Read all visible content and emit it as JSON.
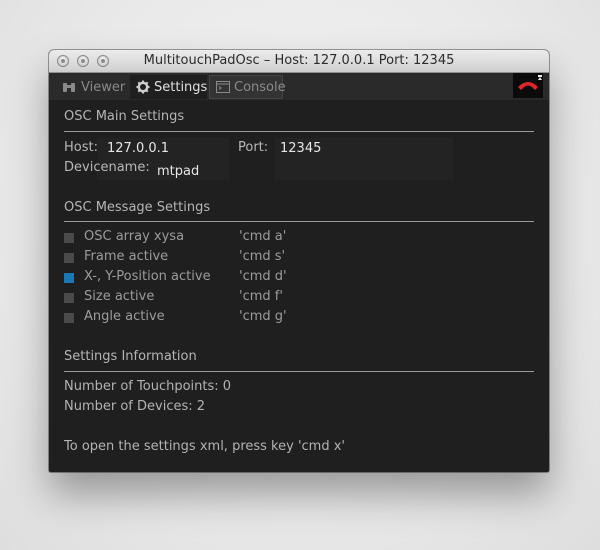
{
  "window": {
    "title": "MultitouchPadOsc – Host: 127.0.0.1 Port: 12345"
  },
  "tabs": [
    {
      "label": "Viewer",
      "icon": "binoculars-icon",
      "active": false
    },
    {
      "label": "Settings",
      "icon": "gear-icon",
      "active": true
    },
    {
      "label": "Console",
      "icon": "console-icon",
      "active": false
    }
  ],
  "toolbar": {
    "connection_icon": "phone-icon",
    "accent": "#e0242a"
  },
  "main_settings": {
    "title": "OSC Main Settings",
    "host_label": "Host:",
    "host_value": "127.0.0.1",
    "port_label": "Port:",
    "port_value": "12345",
    "device_label": "Devicename:",
    "device_value": "mtpad"
  },
  "message_settings": {
    "title": "OSC Message Settings",
    "items": [
      {
        "label": "OSC array xysa",
        "command": "'cmd a'",
        "checked": false
      },
      {
        "label": "Frame active",
        "command": "'cmd s'",
        "checked": false
      },
      {
        "label": "X-, Y-Position active",
        "command": "'cmd d'",
        "checked": true
      },
      {
        "label": "Size active",
        "command": "'cmd f'",
        "checked": false
      },
      {
        "label": "Angle active",
        "command": "'cmd g'",
        "checked": false
      }
    ],
    "checked_color": "#1a79b3"
  },
  "info": {
    "title": "Settings Information",
    "touchpoints": "Number of Touchpoints: 0",
    "devices": "Number of Devices: 2",
    "hint": "To open the settings xml, press key 'cmd x'"
  }
}
